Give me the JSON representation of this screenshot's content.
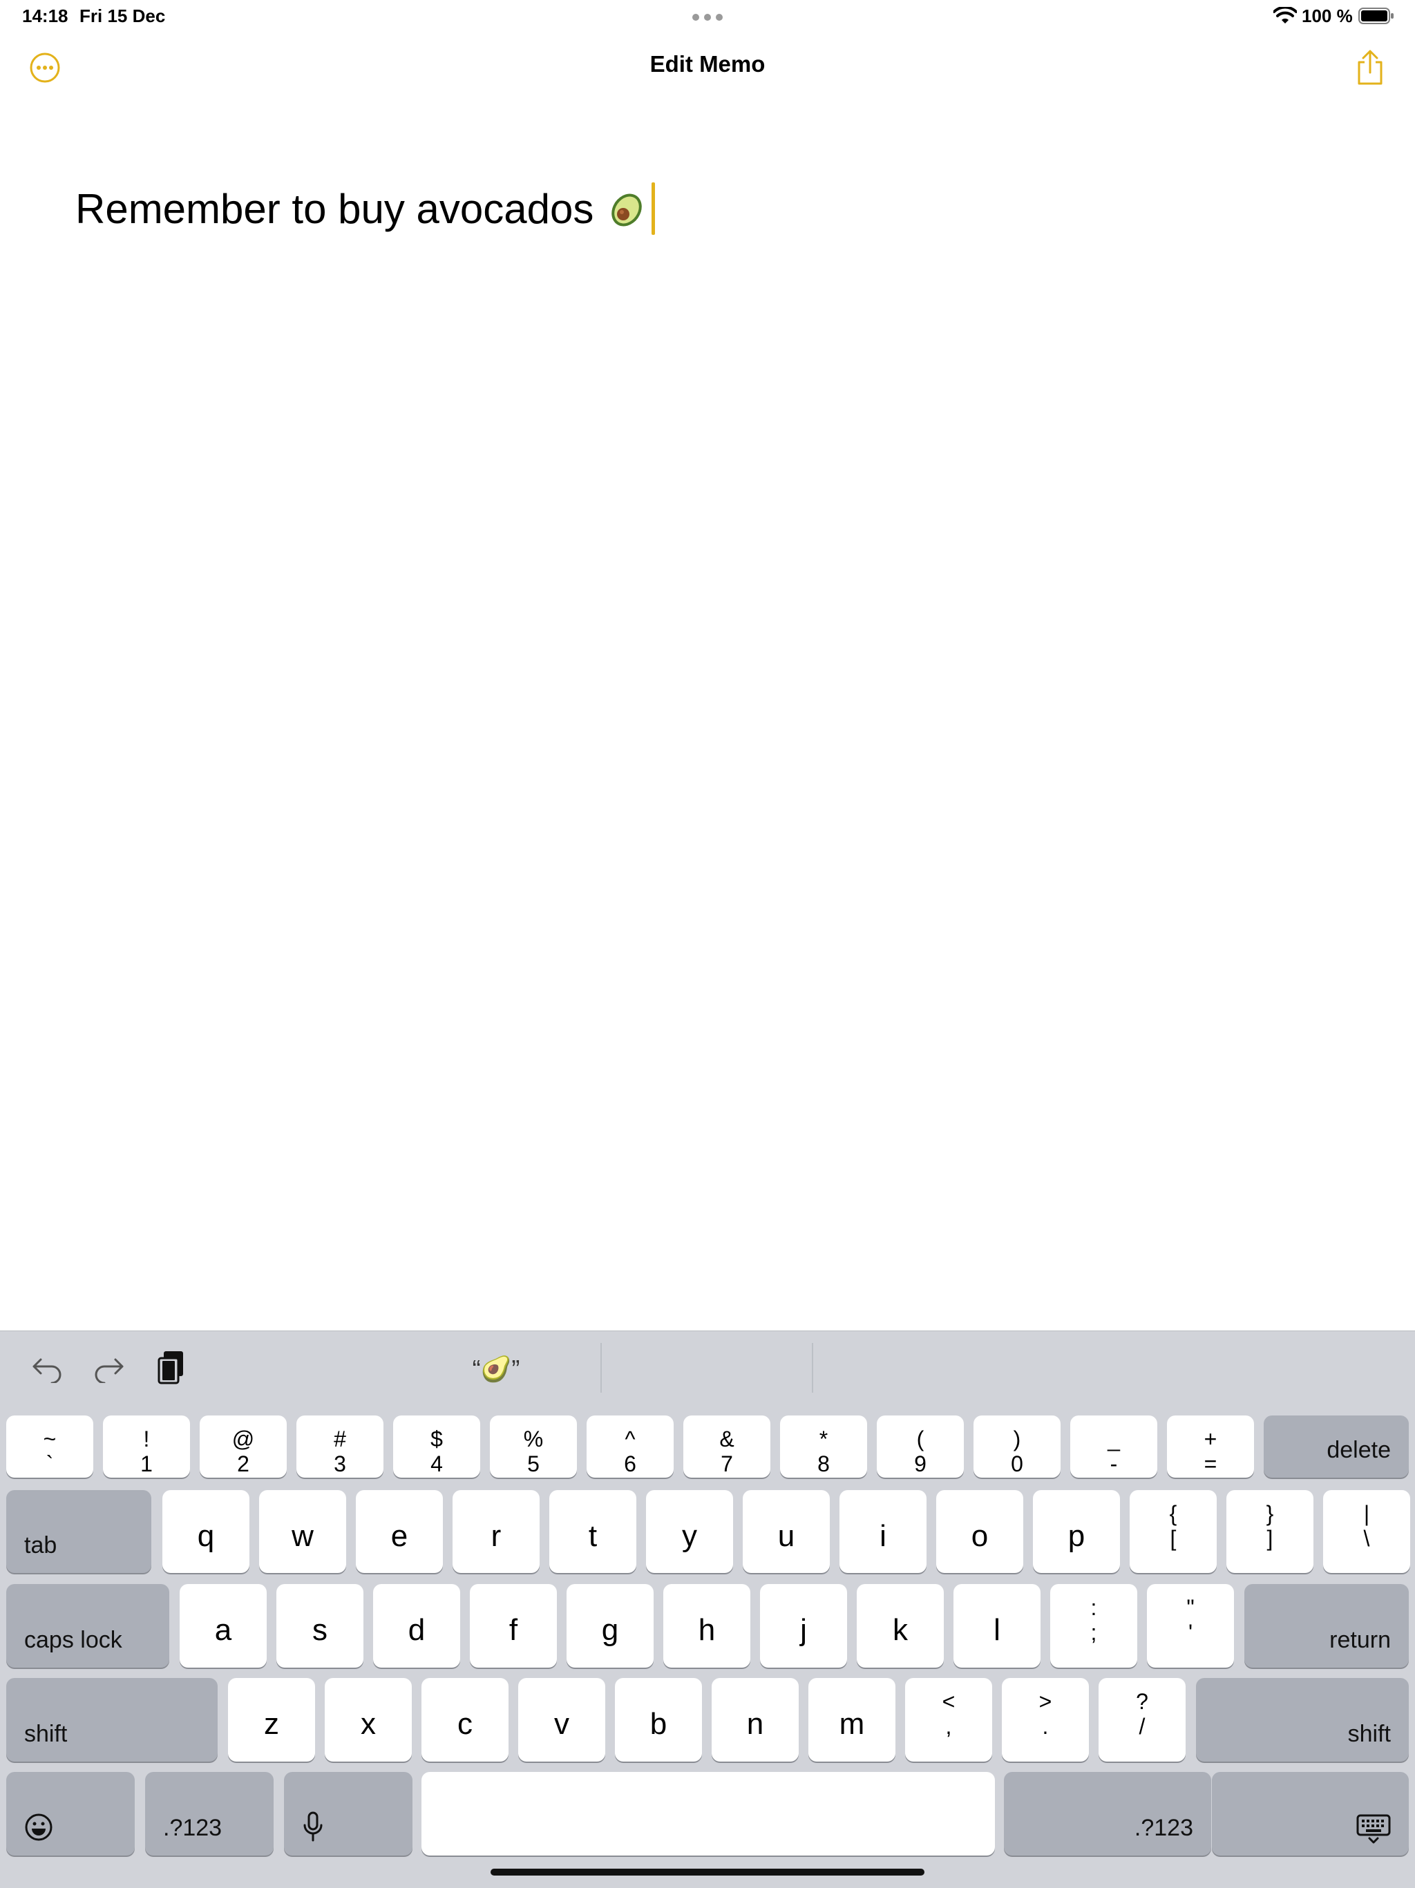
{
  "status_bar": {
    "time": "14:18",
    "date": "Fri 15 Dec",
    "battery": "100 %"
  },
  "nav": {
    "title": "Edit Memo",
    "more_icon": "ellipsis-circle-icon",
    "share_icon": "share-icon",
    "accent_color": "#e3b21b"
  },
  "memo": {
    "text": "Remember to buy avocados",
    "emoji": "avocado-icon"
  },
  "keyboard": {
    "suggestion": "“🥑”",
    "toolbar": [
      "undo-icon",
      "redo-icon",
      "paste-icon"
    ],
    "row1": [
      {
        "top": "~",
        "bot": "`"
      },
      {
        "top": "!",
        "bot": "1"
      },
      {
        "top": "@",
        "bot": "2"
      },
      {
        "top": "#",
        "bot": "3"
      },
      {
        "top": "$",
        "bot": "4"
      },
      {
        "top": "%",
        "bot": "5"
      },
      {
        "top": "^",
        "bot": "6"
      },
      {
        "top": "&",
        "bot": "7"
      },
      {
        "top": "*",
        "bot": "8"
      },
      {
        "top": "(",
        "bot": "9"
      },
      {
        "top": ")",
        "bot": "0"
      },
      {
        "top": "_",
        "bot": "-"
      },
      {
        "top": "+",
        "bot": "="
      }
    ],
    "delete": "delete",
    "tab": "tab",
    "row2": [
      "q",
      "w",
      "e",
      "r",
      "t",
      "y",
      "u",
      "i",
      "o",
      "p"
    ],
    "row2_sym": [
      {
        "top": "{",
        "bot": "["
      },
      {
        "top": "}",
        "bot": "]"
      },
      {
        "top": "|",
        "bot": "\\"
      }
    ],
    "caps_lock": "caps lock",
    "row3": [
      "a",
      "s",
      "d",
      "f",
      "g",
      "h",
      "j",
      "k",
      "l"
    ],
    "row3_sym": [
      {
        "top": ":",
        "bot": ";"
      },
      {
        "top": "\"",
        "bot": "'"
      }
    ],
    "return": "return",
    "shift": "shift",
    "row4": [
      "z",
      "x",
      "c",
      "v",
      "b",
      "n",
      "m"
    ],
    "row4_sym": [
      {
        "top": "<",
        "bot": ","
      },
      {
        "top": ">",
        "bot": "."
      },
      {
        "top": "?",
        "bot": "/"
      }
    ],
    "numbers": ".?123",
    "space": "",
    "icons": {
      "emoji": "emoji-icon",
      "mic": "microphone-icon",
      "dismiss": "keyboard-dismiss-icon"
    }
  }
}
